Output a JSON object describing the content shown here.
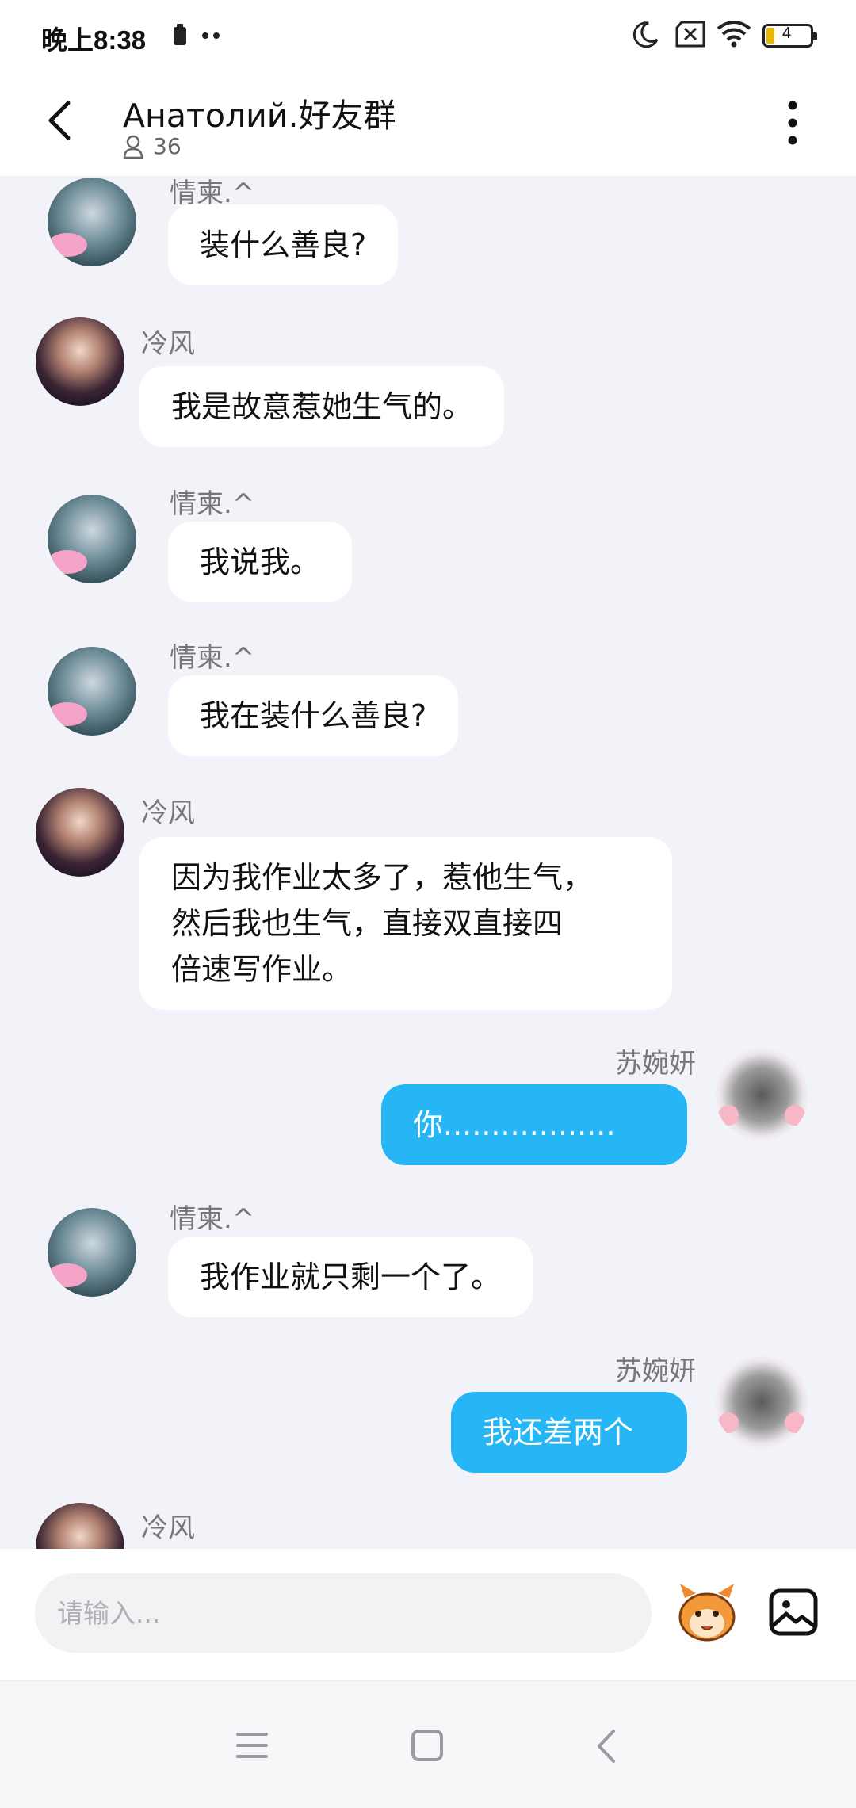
{
  "status": {
    "time": "晚上8:38",
    "battery": "4"
  },
  "header": {
    "title": "Анатолий.好友群",
    "member_count": "36"
  },
  "messages": [
    {
      "sender": "情柬.^",
      "text": "装什么善良?"
    },
    {
      "sender": "冷风",
      "text": "我是故意惹她生气的。"
    },
    {
      "sender": "情柬.^",
      "text": "我说我。"
    },
    {
      "sender": "情柬.^",
      "text": "我在装什么善良?"
    },
    {
      "sender": "冷风",
      "lines": [
        "因为我作业太多了，惹他生气，",
        "然后我也生气，直接双直接四",
        "倍速写作业。"
      ]
    },
    {
      "sender": "苏婉妍",
      "text": "你.................."
    },
    {
      "sender": "情柬.^",
      "text": "我作业就只剩一个了。"
    },
    {
      "sender": "苏婉妍",
      "text": "我还差两个"
    },
    {
      "sender": "冷风"
    }
  ],
  "input": {
    "placeholder": "请输入..."
  },
  "colors": {
    "chat_bg": "#f1f3f8",
    "my_bubble": "#27b6f5",
    "other_bubble": "#ffffff"
  },
  "icons": [
    "back-icon",
    "more-icon",
    "person-icon",
    "emoji-mascot-icon",
    "image-icon",
    "menu-icon",
    "home-icon",
    "nav-back-icon"
  ]
}
